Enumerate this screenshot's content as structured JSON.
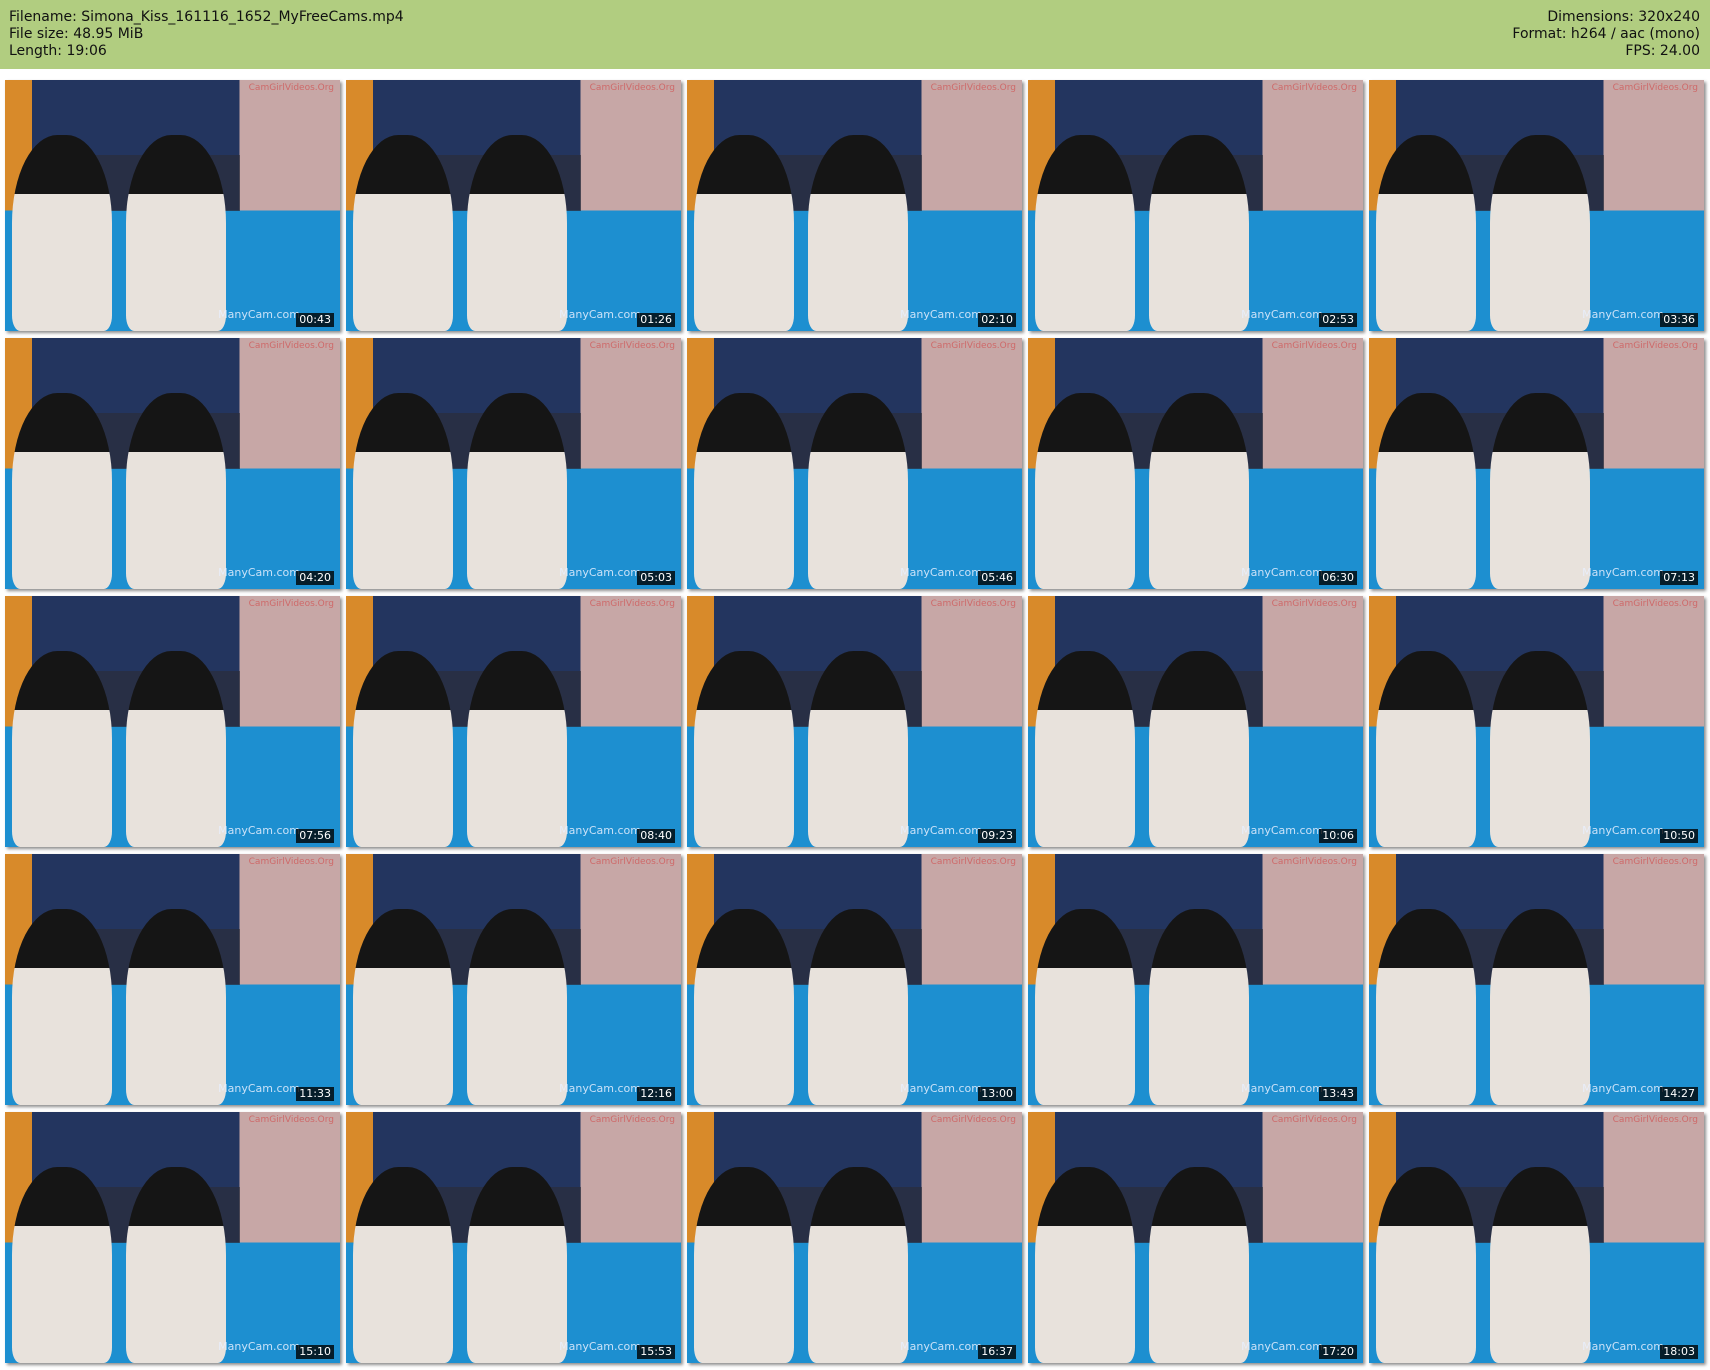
{
  "header": {
    "filename": "Filename: Simona_Kiss_161116_1652_MyFreeCams.mp4",
    "filesize": "File size: 48.95 MiB",
    "length": "Length: 19:06",
    "dimensions": "Dimensions: 320x240",
    "format": "Format: h264 / aac (mono)",
    "fps": "FPS: 24.00"
  },
  "watermarks": {
    "top": "CamGirlVideos.Org",
    "bottom": "ManyCam.com"
  },
  "colors": {
    "header_bg": "#b1cd80"
  },
  "timestamps": [
    "00:43",
    "01:26",
    "02:10",
    "02:53",
    "03:36",
    "04:20",
    "05:03",
    "05:46",
    "06:30",
    "07:13",
    "07:56",
    "08:40",
    "09:23",
    "10:06",
    "10:50",
    "11:33",
    "12:16",
    "13:00",
    "13:43",
    "14:27",
    "15:10",
    "15:53",
    "16:37",
    "17:20",
    "18:03"
  ]
}
